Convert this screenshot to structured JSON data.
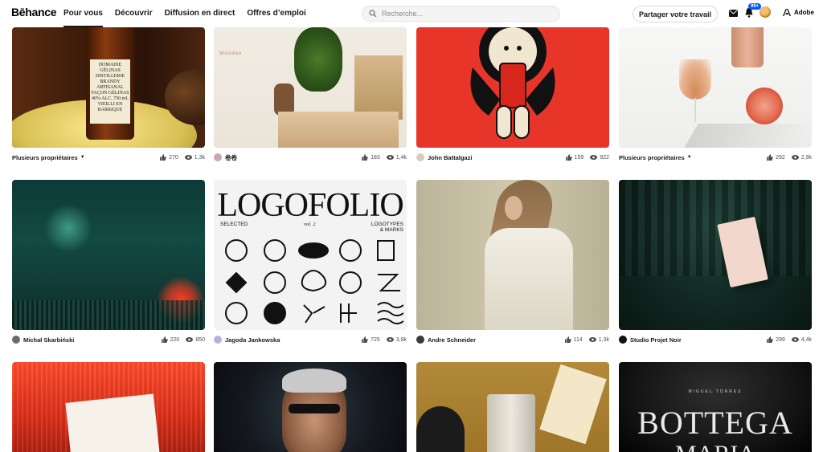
{
  "header": {
    "logo": "Bēhance",
    "nav": [
      "Pour vous",
      "Découvrir",
      "Diffusion en direct",
      "Offres d’emploi"
    ],
    "active_nav": "Pour vous",
    "search_placeholder": "Recherche...",
    "share_label": "Partager votre travail",
    "notifications_badge": "99+",
    "adobe_label": "Adobe"
  },
  "cards": [
    {
      "owner": "Plusieurs propriétaires",
      "likes": "270",
      "views": "1,3k"
    },
    {
      "owner": "卷卷",
      "likes": "183",
      "views": "1,4k"
    },
    {
      "owner": "John Battalgazi",
      "likes": "159",
      "views": "922"
    },
    {
      "owner": "Plusieurs propriétaires",
      "likes": "292",
      "views": "2,9k"
    },
    {
      "owner": "Michał Skarbiński",
      "likes": "220",
      "views": "850"
    },
    {
      "owner": "Jagoda Jankowska",
      "likes": "725",
      "views": "3,8k"
    },
    {
      "owner": "Andre Schneider",
      "likes": "114",
      "views": "1,3k"
    },
    {
      "owner": "Studio Projet Noir",
      "likes": "299",
      "views": "4,4k"
    }
  ],
  "artwork_text": {
    "bottle_label": "DOMAINE GÉLINAS DISTILLERIE BRANDY ARTISANAL FAÇON GÉLINAS 40% ALC. 750 mL VIEILLI EN BARRIQUE",
    "wooden_sign": "Wooden",
    "logofolio_title": "LOGOFOLIO",
    "logofolio_left": "SELECTED",
    "logofolio_mid": "vol. 2",
    "logofolio_right": "LOGOTYPES & MARKS",
    "bottega_top": "MIGUEL   TORRES",
    "bottega_word": "BOTTEGA",
    "bottega_word2": "MARIA"
  },
  "colors": {
    "accent": "#0057ff"
  }
}
